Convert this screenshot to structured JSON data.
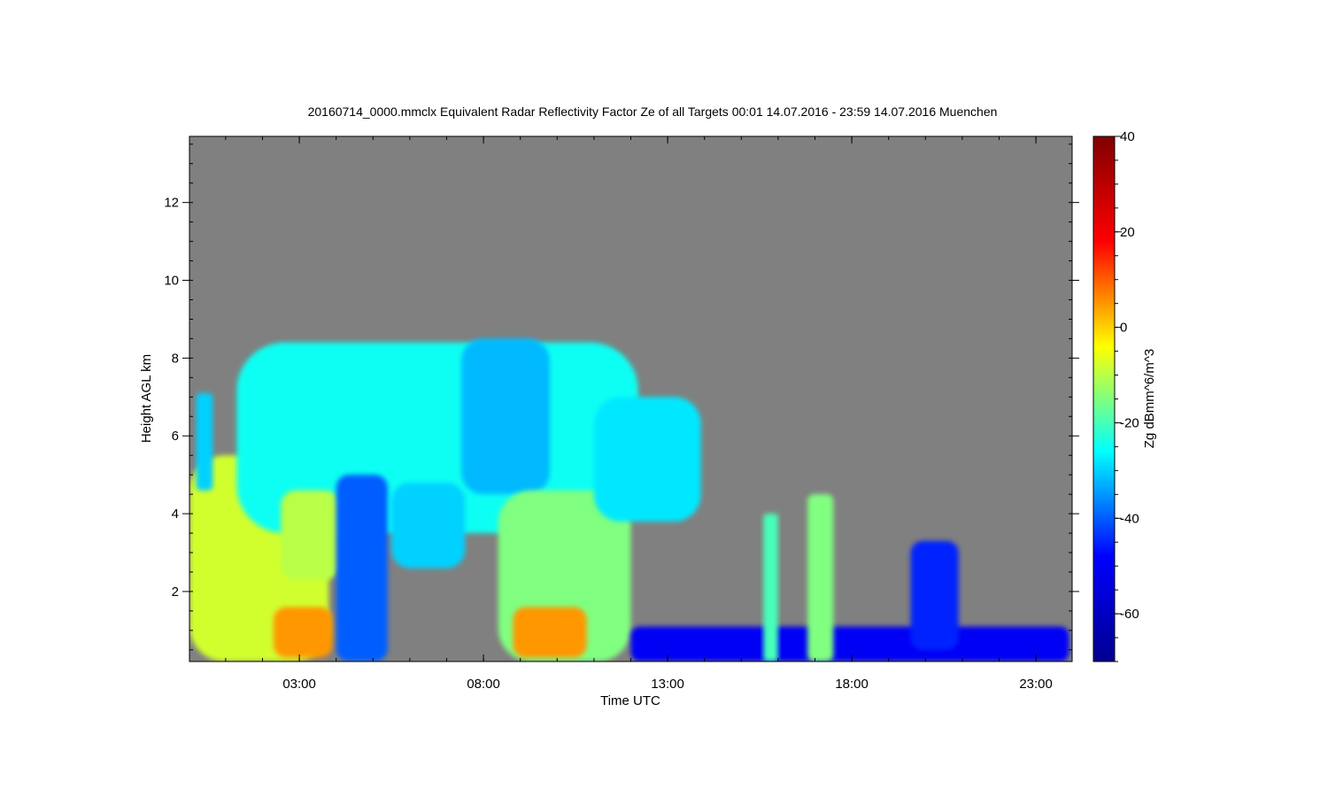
{
  "chart_data": {
    "type": "heatmap",
    "title": "20160714_0000.mmclx Equivalent Radar Reflectivity Factor Ze of all Targets   00:01 14.07.2016 - 23:59 14.07.2016 Muenchen",
    "xlabel": "Time UTC",
    "ylabel": "Height AGL km",
    "colorbar_label": "Zg dBmm^6/m^3",
    "xlim": [
      "00:01",
      "23:59"
    ],
    "x_ticks": [
      "03:00",
      "08:00",
      "13:00",
      "18:00",
      "23:00"
    ],
    "ylim": [
      0.2,
      13.7
    ],
    "y_ticks": [
      2,
      4,
      6,
      8,
      10,
      12
    ],
    "colorbar_range": [
      -70,
      40
    ],
    "colorbar_ticks": [
      40,
      20,
      0,
      -20,
      -40,
      -60
    ],
    "colormap": [
      "#00008f",
      "#0000ff",
      "#00ffff",
      "#ffff00",
      "#ff0000",
      "#800000"
    ],
    "background_color": "#808080",
    "echo_features": [
      {
        "t_start": 0.02,
        "t_end": 3.8,
        "z_bottom": 0.2,
        "z_top": 5.5,
        "dbz": -8
      },
      {
        "t_start": 0.2,
        "t_end": 0.65,
        "z_bottom": 4.6,
        "z_top": 7.1,
        "dbz": -30
      },
      {
        "t_start": 1.3,
        "t_end": 12.2,
        "z_bottom": 3.5,
        "z_top": 8.4,
        "dbz": -25
      },
      {
        "t_start": 2.5,
        "t_end": 4.1,
        "z_bottom": 2.3,
        "z_top": 4.6,
        "dbz": -10
      },
      {
        "t_start": 4.0,
        "t_end": 5.4,
        "z_bottom": 0.2,
        "z_top": 5.0,
        "dbz": -40
      },
      {
        "t_start": 5.5,
        "t_end": 7.5,
        "z_bottom": 2.6,
        "z_top": 4.8,
        "dbz": -30
      },
      {
        "t_start": 7.4,
        "t_end": 9.8,
        "z_bottom": 4.5,
        "z_top": 8.5,
        "dbz": -32
      },
      {
        "t_start": 8.4,
        "t_end": 12.0,
        "z_bottom": 0.2,
        "z_top": 4.6,
        "dbz": -15
      },
      {
        "t_start": 11.0,
        "t_end": 13.9,
        "z_bottom": 3.8,
        "z_top": 7.0,
        "dbz": -28
      },
      {
        "t_start": 2.3,
        "t_end": 3.9,
        "z_bottom": 0.3,
        "z_top": 1.6,
        "dbz": 5
      },
      {
        "t_start": 8.8,
        "t_end": 10.8,
        "z_bottom": 0.3,
        "z_top": 1.6,
        "dbz": 5
      },
      {
        "t_start": 12.0,
        "t_end": 23.9,
        "z_bottom": 0.2,
        "z_top": 1.1,
        "dbz": -50
      },
      {
        "t_start": 15.6,
        "t_end": 16.0,
        "z_bottom": 0.2,
        "z_top": 4.0,
        "dbz": -20
      },
      {
        "t_start": 16.8,
        "t_end": 17.5,
        "z_bottom": 0.2,
        "z_top": 4.5,
        "dbz": -15
      },
      {
        "t_start": 19.6,
        "t_end": 20.9,
        "z_bottom": 0.5,
        "z_top": 3.3,
        "dbz": -45
      }
    ]
  }
}
